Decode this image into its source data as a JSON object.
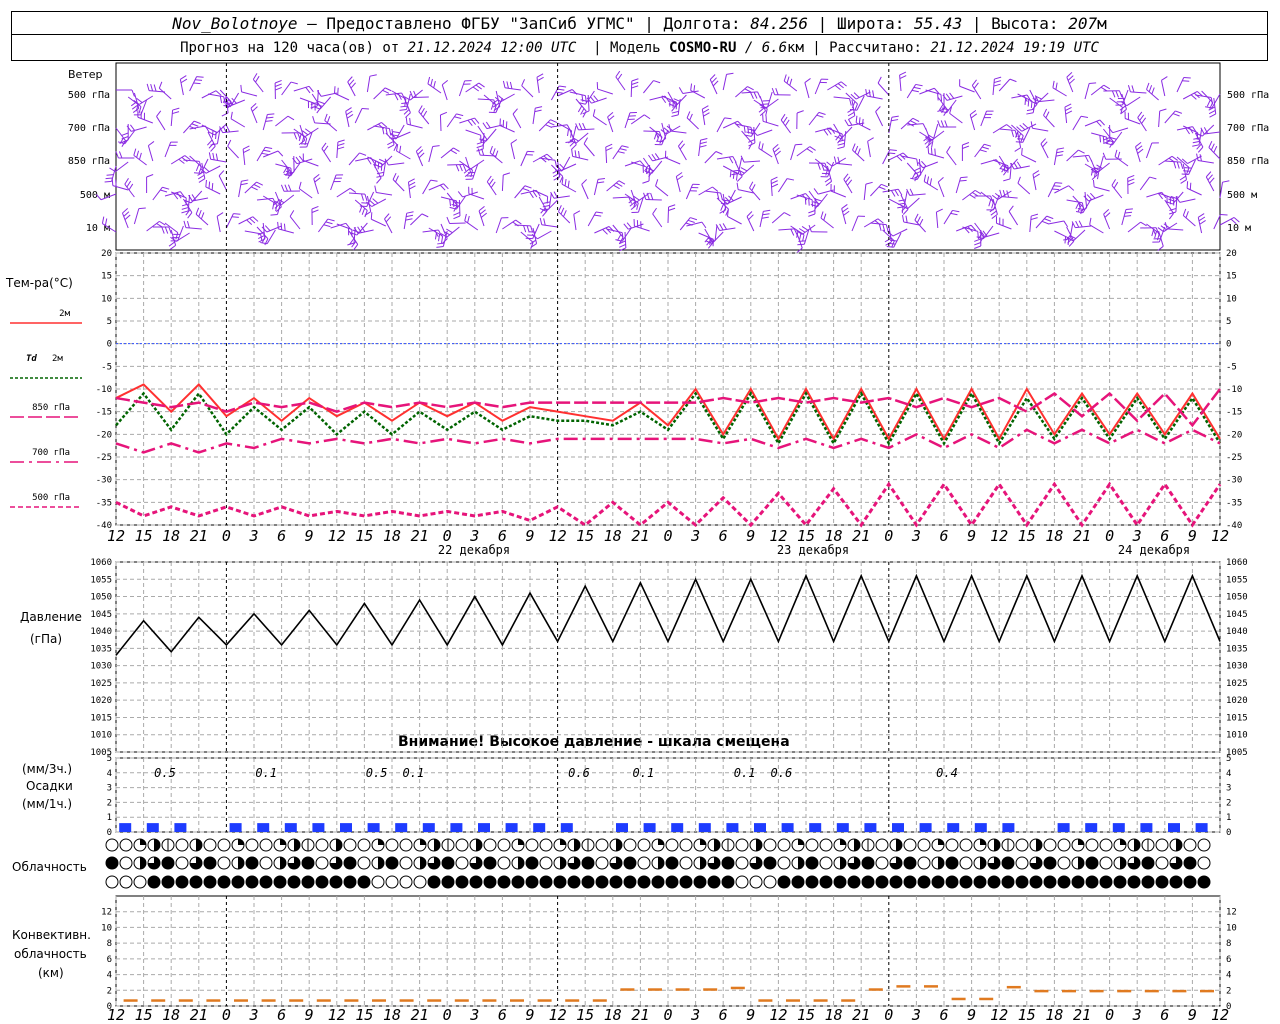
{
  "header": {
    "station": "Nov_Bolotnoye",
    "provided_by": "– Предоставлено ФГБУ \"ЗапСиб УГМС\"",
    "lon_label": "Долгота:",
    "lon_value": "84.256",
    "lat_label": "Широта:",
    "lat_value": "55.43",
    "alt_label": "Высота:",
    "alt_value": "207",
    "alt_unit": "м",
    "forecast_text": "Прогноз на 120 часа(ов) от",
    "forecast_time": "21.12.2024 12:00 UTC",
    "model_label": "Модель",
    "model_name": "COSMO-RU",
    "model_res": "/ 6.6",
    "model_res_unit": "км",
    "calc_label": "Рассчитано:",
    "calc_time": "21.12.2024 19:19 UTC"
  },
  "labels": {
    "wind": "Ветер",
    "wind_levels": [
      "500 гПа",
      "700 гПа",
      "850 гПа",
      "500 м",
      "10  м"
    ],
    "temp_title": "Тем-ра(°С)",
    "t2m": "2м",
    "td2m_a": "Td",
    "td2m_b": "2м",
    "t850": "850 гПа",
    "t700": "700 гПа",
    "t500": "500 гПа",
    "pressure_a": "Давление",
    "pressure_b": "(гПа)",
    "pressure_warning": "Внимание! Высокое давление - шкала смещена",
    "precip_a": "(мм/3ч.)",
    "precip_b": "Осадки",
    "precip_c": "(мм/1ч.)",
    "cloud": "Облачность",
    "conv_a": "Конвективн.",
    "conv_b": "облачность",
    "conv_c": "(км)"
  },
  "colors": {
    "t2m": "#ff3030",
    "td": "#006400",
    "upper": "#e6147a",
    "wind": "#8a2be2",
    "precip": "#1e3cff",
    "conv": "#e07a20",
    "zero_line": "#3050ff"
  },
  "chart_data": [
    {
      "type": "line",
      "name": "temperature",
      "x_hours": [
        0,
        3,
        6,
        9,
        12,
        15,
        18,
        21,
        24,
        27,
        30,
        33,
        36,
        39,
        42,
        45,
        48,
        51,
        54,
        57,
        60,
        63,
        66,
        69,
        72,
        75,
        78,
        81,
        84,
        87,
        90,
        93,
        96,
        99,
        102,
        105,
        108,
        111,
        114,
        117,
        120
      ],
      "x_tick_labels": [
        "12",
        "15",
        "18",
        "21",
        "0",
        "3",
        "6",
        "9",
        "12",
        "15",
        "18",
        "21",
        "0",
        "3",
        "6",
        "9",
        "12",
        "15",
        "18",
        "21",
        "0",
        "3",
        "6",
        "9",
        "12",
        "15",
        "18"
      ],
      "day_labels": [
        "22 декабря",
        "23 декабря",
        "24 декабря"
      ],
      "ylim": [
        -40,
        20
      ],
      "yticks": [
        20,
        15,
        10,
        5,
        0,
        -5,
        -10,
        -15,
        -20,
        -25,
        -30,
        -35,
        -40
      ],
      "series": [
        {
          "name": "2м",
          "values": [
            -12,
            -9,
            -15,
            -9,
            -16,
            -12,
            -17,
            -12,
            -16,
            -13,
            -17,
            -13,
            -16,
            -13,
            -17,
            -14,
            -15,
            -16,
            -17,
            -13,
            -18,
            -10,
            -20,
            -10,
            -21,
            -10,
            -21,
            -10,
            -21,
            -10,
            -21,
            -10,
            -21,
            -10,
            -20,
            -11,
            -20,
            -11,
            -20,
            -11,
            -21
          ]
        },
        {
          "name": "Td 2м",
          "values": [
            -18,
            -11,
            -19,
            -11,
            -20,
            -14,
            -19,
            -14,
            -20,
            -15,
            -20,
            -15,
            -19,
            -15,
            -19,
            -16,
            -17,
            -17,
            -18,
            -15,
            -19,
            -11,
            -21,
            -11,
            -22,
            -11,
            -22,
            -11,
            -22,
            -11,
            -22,
            -11,
            -22,
            -12,
            -21,
            -12,
            -21,
            -12,
            -21,
            -12,
            -22
          ]
        },
        {
          "name": "850 гПа",
          "values": [
            -12,
            -13,
            -14,
            -13,
            -15,
            -13,
            -14,
            -13,
            -15,
            -13,
            -14,
            -13,
            -14,
            -13,
            -14,
            -13,
            -13,
            -13,
            -13,
            -13,
            -13,
            -13,
            -12,
            -13,
            -12,
            -13,
            -12,
            -13,
            -12,
            -14,
            -12,
            -14,
            -12,
            -15,
            -11,
            -16,
            -11,
            -17,
            -11,
            -18,
            -10
          ]
        },
        {
          "name": "700 гПа",
          "values": [
            -22,
            -24,
            -22,
            -24,
            -22,
            -23,
            -21,
            -22,
            -21,
            -22,
            -21,
            -22,
            -21,
            -22,
            -21,
            -22,
            -21,
            -21,
            -21,
            -21,
            -21,
            -21,
            -22,
            -21,
            -23,
            -21,
            -23,
            -21,
            -23,
            -20,
            -23,
            -20,
            -23,
            -19,
            -22,
            -19,
            -22,
            -19,
            -22,
            -19,
            -22
          ]
        },
        {
          "name": "500 гПа",
          "values": [
            -35,
            -38,
            -36,
            -38,
            -36,
            -38,
            -36,
            -38,
            -37,
            -38,
            -37,
            -38,
            -37,
            -38,
            -37,
            -39,
            -36,
            -40,
            -35,
            -40,
            -35,
            -40,
            -34,
            -40,
            -33,
            -40,
            -32,
            -40,
            -31,
            -40,
            -31,
            -40,
            -31,
            -40,
            -31,
            -40,
            -31,
            -40,
            -31,
            -40,
            -31
          ]
        }
      ]
    },
    {
      "type": "line",
      "name": "pressure",
      "ylim": [
        1005,
        1060
      ],
      "yticks": [
        1060,
        1055,
        1050,
        1045,
        1040,
        1035,
        1030,
        1025,
        1020,
        1015,
        1010,
        1005
      ],
      "series": [
        {
          "name": "Давление",
          "values": [
            1033,
            1043,
            1034,
            1044,
            1036,
            1045,
            1036,
            1046,
            1036,
            1048,
            1036,
            1049,
            1036,
            1050,
            1036,
            1051,
            1037,
            1053,
            1037,
            1054,
            1037,
            1055,
            1037,
            1055,
            1037,
            1056,
            1037,
            1056,
            1037,
            1056,
            1037,
            1056,
            1037,
            1056,
            1037,
            1056,
            1037,
            1056,
            1037,
            1056,
            1037
          ]
        }
      ]
    },
    {
      "type": "bar",
      "name": "precipitation",
      "ylim": [
        0,
        5
      ],
      "yticks": [
        5,
        4,
        3,
        2,
        1,
        0
      ],
      "x_hours": [
        1,
        4,
        7,
        10,
        13,
        16,
        19,
        22,
        25,
        28,
        31,
        34,
        37,
        40,
        43,
        46,
        49,
        52,
        55,
        58,
        61,
        64,
        67,
        70,
        73,
        76,
        79,
        82,
        85,
        88,
        91,
        94,
        97,
        100,
        103,
        106,
        109,
        112,
        115,
        118
      ],
      "values": [
        0.6,
        0.6,
        0.6,
        0,
        0.6,
        0.6,
        0.6,
        0.6,
        0.6,
        0.6,
        0.6,
        0.6,
        0.6,
        0.6,
        0.6,
        0.6,
        0.6,
        0,
        0.6,
        0.6,
        0.6,
        0.6,
        0.6,
        0.6,
        0.6,
        0.6,
        0.6,
        0.6,
        0.6,
        0.6,
        0.6,
        0.6,
        0.6,
        0,
        0.6,
        0.6,
        0.6,
        0.6,
        0.6,
        0.6
      ],
      "amounts_3h": [
        {
          "hour": 5,
          "label": "0.5"
        },
        {
          "hour": 16,
          "label": "0.1"
        },
        {
          "hour": 28,
          "label": "0.5"
        },
        {
          "hour": 32,
          "label": "0.1"
        },
        {
          "hour": 50,
          "label": "0.6"
        },
        {
          "hour": 57,
          "label": "0.1"
        },
        {
          "hour": 68,
          "label": "0.1"
        },
        {
          "hour": 72,
          "label": "0.6"
        },
        {
          "hour": 90,
          "label": "0.4"
        }
      ]
    },
    {
      "type": "bar",
      "name": "convective_cloud",
      "ylim": [
        0,
        14
      ],
      "yticks": [
        12,
        10,
        8,
        6,
        4,
        2,
        0
      ],
      "x_hours": [
        3,
        6,
        9,
        12,
        15,
        18,
        21,
        24,
        27,
        30,
        33,
        36,
        39,
        42,
        45,
        48,
        51,
        54,
        57,
        60,
        63,
        66,
        69,
        72,
        75,
        78,
        81,
        84,
        87,
        90,
        93,
        96,
        99,
        102,
        105,
        108,
        111,
        114,
        117,
        120
      ],
      "values": [
        0.6,
        0.6,
        0.6,
        0.6,
        0.6,
        0.6,
        0.6,
        0.6,
        0.6,
        0.6,
        0.6,
        0.6,
        0.6,
        0.6,
        0.6,
        0.6,
        0.6,
        0.6,
        2.0,
        2.0,
        2.0,
        2.0,
        2.2,
        0.6,
        0.6,
        0.6,
        0.6,
        2.0,
        2.4,
        2.4,
        0.8,
        0.8,
        2.3,
        1.8,
        1.8,
        1.8,
        1.8,
        1.8,
        1.8,
        1.8
      ]
    }
  ]
}
